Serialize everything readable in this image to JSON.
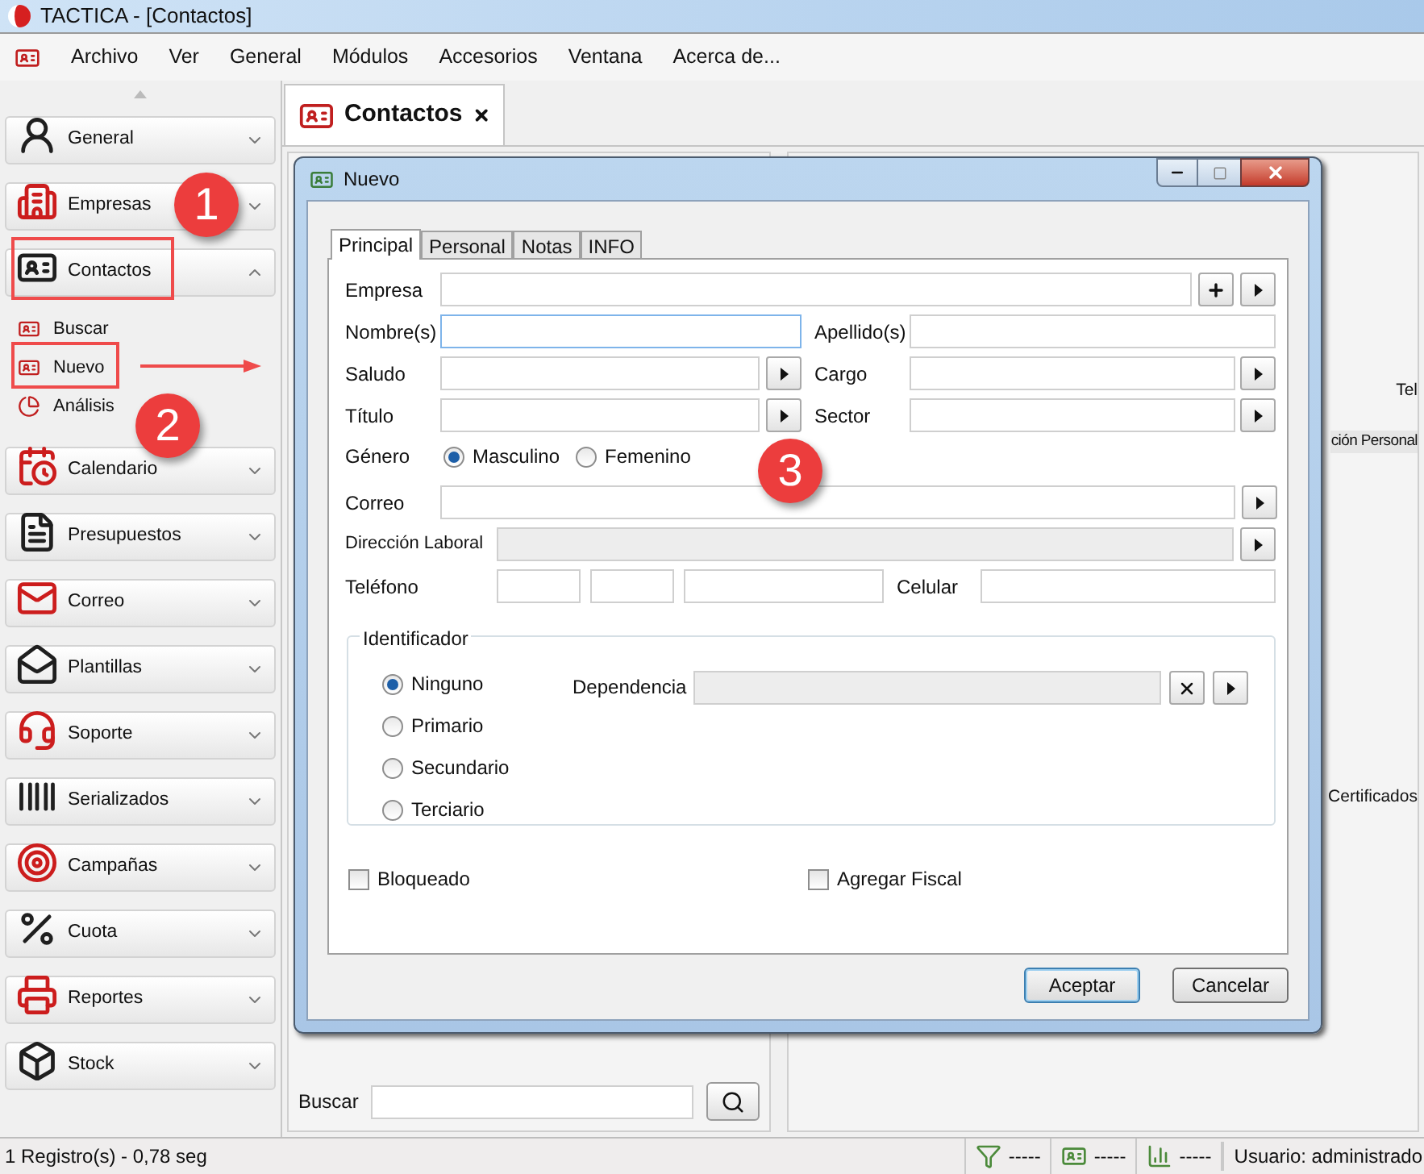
{
  "window": {
    "title": "TACTICA - [Contactos]"
  },
  "menu": [
    "Archivo",
    "Ver",
    "General",
    "Módulos",
    "Accesorios",
    "Ventana",
    "Acerca de..."
  ],
  "sidebar": {
    "items": [
      {
        "label": "General",
        "expanded": false
      },
      {
        "label": "Empresas",
        "expanded": false
      },
      {
        "label": "Contactos",
        "expanded": true,
        "children": [
          {
            "label": "Buscar",
            "selected": false
          },
          {
            "label": "Nuevo",
            "selected": false
          },
          {
            "label": "Análisis",
            "selected": false
          }
        ]
      },
      {
        "label": "Calendario",
        "expanded": false
      },
      {
        "label": "Presupuestos",
        "expanded": false
      },
      {
        "label": "Correo",
        "expanded": false
      },
      {
        "label": "Plantillas",
        "expanded": false
      },
      {
        "label": "Soporte",
        "expanded": false
      },
      {
        "label": "Serializados",
        "expanded": false
      },
      {
        "label": "Campañas",
        "expanded": false
      },
      {
        "label": "Cuota",
        "expanded": false
      },
      {
        "label": "Reportes",
        "expanded": false
      },
      {
        "label": "Stock",
        "expanded": false
      }
    ]
  },
  "document_tab": {
    "label": "Contactos"
  },
  "list_panel": {
    "search_label": "Buscar"
  },
  "detail_fragments": [
    "Tel",
    "ción Personal",
    "Certificados"
  ],
  "dialog": {
    "title": "Nuevo",
    "tabs": [
      {
        "label": "Principal",
        "selected": true
      },
      {
        "label": "Personal",
        "selected": false
      },
      {
        "label": "Notas",
        "selected": false
      },
      {
        "label": "INFO",
        "selected": false
      }
    ],
    "empresa": {
      "label": "Empresa"
    },
    "nombre": {
      "label": "Nombre(s)",
      "focused": true
    },
    "apellido": {
      "label": "Apellido(s)"
    },
    "saludo": {
      "label": "Saludo"
    },
    "cargo": {
      "label": "Cargo"
    },
    "titulo": {
      "label": "Título"
    },
    "sector": {
      "label": "Sector"
    },
    "genero": {
      "label": "Género",
      "options": [
        {
          "label": "Masculino",
          "selected": true
        },
        {
          "label": "Femenino",
          "selected": false
        }
      ]
    },
    "correo": {
      "label": "Correo"
    },
    "direccion": {
      "label": "Dirección Laboral",
      "disabled": true
    },
    "telefono": {
      "label": "Teléfono"
    },
    "celular": {
      "label": "Celular"
    },
    "identificador": {
      "legend": "Identificador",
      "options": [
        {
          "label": "Ninguno",
          "selected": true
        },
        {
          "label": "Primario",
          "selected": false
        },
        {
          "label": "Secundario",
          "selected": false
        },
        {
          "label": "Terciario",
          "selected": false
        }
      ],
      "dependencia": {
        "label": "Dependencia",
        "disabled": true
      }
    },
    "checkboxes": [
      {
        "label": "Bloqueado",
        "checked": false
      },
      {
        "label": "Agregar Fiscal",
        "checked": false
      }
    ],
    "buttons": [
      {
        "label": "Aceptar",
        "default": true
      },
      {
        "label": "Cancelar",
        "default": false
      }
    ]
  },
  "annotations": [
    {
      "label": "1"
    },
    {
      "label": "2"
    },
    {
      "label": "3"
    }
  ],
  "status_bar": {
    "records": "1 Registro(s) - 0,78 seg",
    "counters": [
      "-----",
      "-----",
      "-----"
    ],
    "user": "Usuario: administrado"
  }
}
